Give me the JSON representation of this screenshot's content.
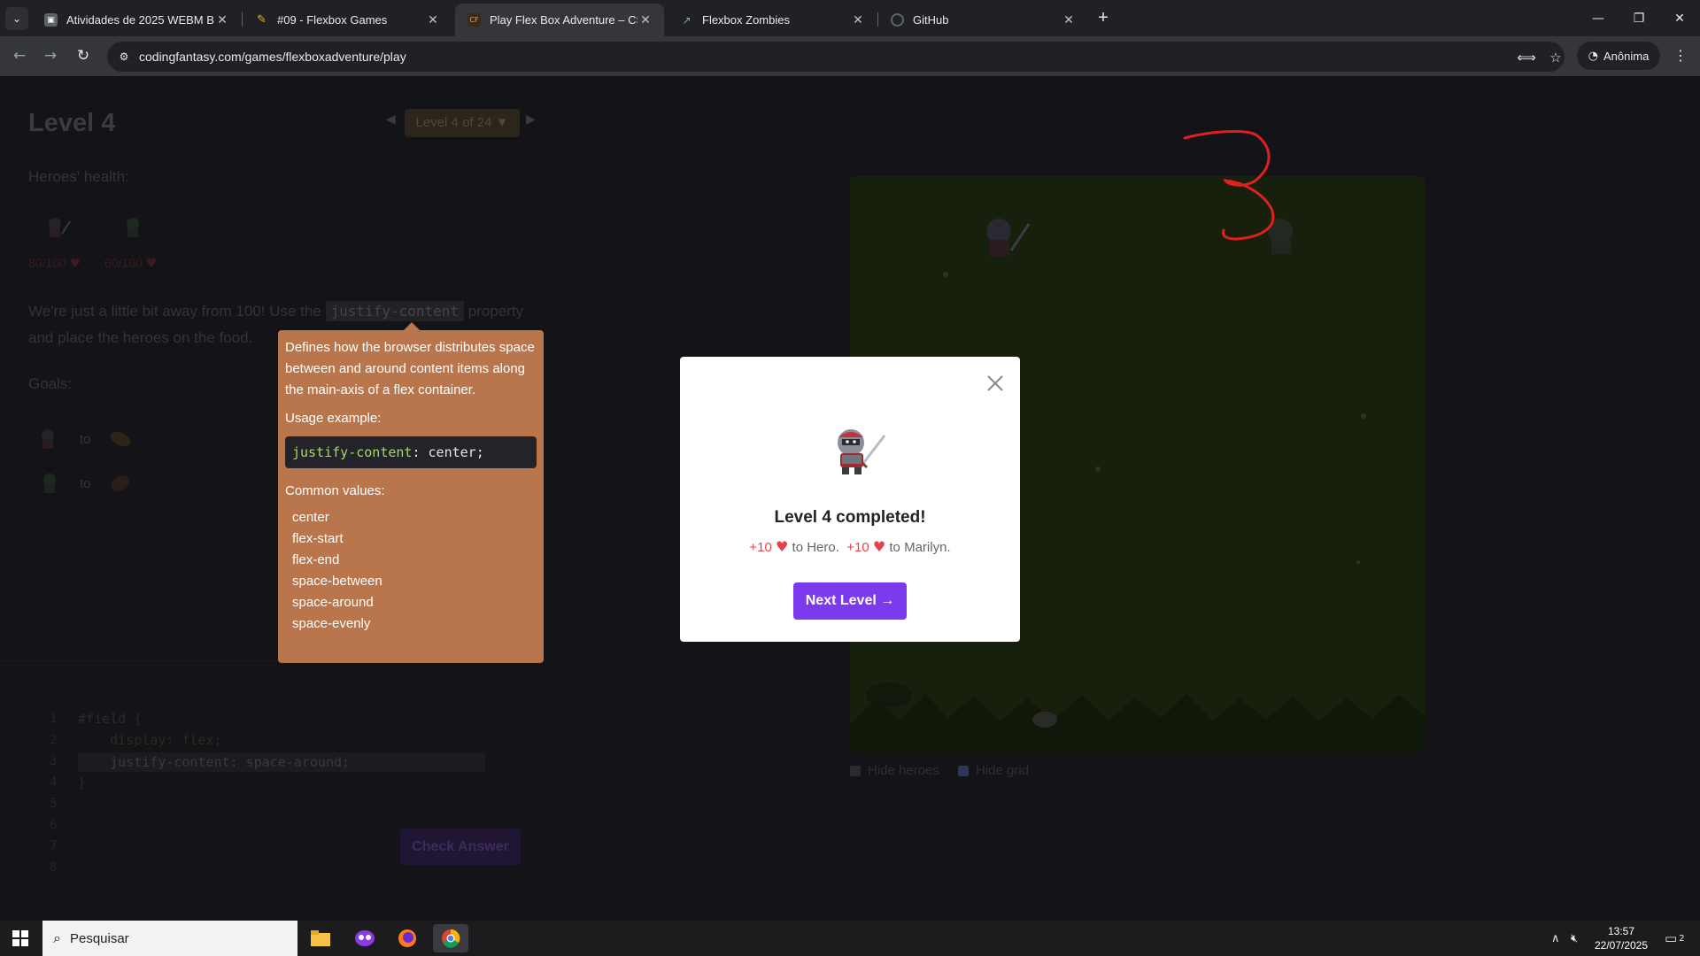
{
  "browser": {
    "tabs": [
      {
        "title": "Atividades de 2025 WEBM B",
        "active": false
      },
      {
        "title": "#09 - Flexbox Games",
        "active": false
      },
      {
        "title": "Play Flex Box Adventure – CSS C",
        "active": true
      },
      {
        "title": "Flexbox Zombies",
        "active": false
      },
      {
        "title": "GitHub",
        "active": false
      }
    ],
    "url": "codingfantasy.com/games/flexboxadventure/play",
    "profile_label": "Anônima"
  },
  "level": {
    "title": "Level 4",
    "selector_label": "Level 4 of 24 ▼",
    "heroes_health_label": "Heroes' health:",
    "hero1_health": "80/100",
    "hero2_health": "60/100",
    "instruction_part1": "We're just a little bit away from 100! Use the",
    "instruction_code": "justify-content",
    "instruction_part2": "property",
    "instruction_part3": "and place the heroes on the food.",
    "goals_label": "Goals:",
    "goal_to": "to"
  },
  "tooltip": {
    "description": "Defines how the browser distributes space between and around content items along the main-axis of a flex container.",
    "usage_label": "Usage example:",
    "usage_prop": "justify-content",
    "usage_value": ": center;",
    "common_label": "Common values:",
    "values": [
      "center",
      "flex-start",
      "flex-end",
      "space-between",
      "space-around",
      "space-evenly"
    ]
  },
  "editor": {
    "line_numbers": [
      "1",
      "2",
      "3",
      "4",
      "5",
      "6",
      "7",
      "8"
    ],
    "lines": [
      "#field {",
      "    display: flex;",
      "    justify-content: space-around;",
      "}"
    ],
    "check_button": "Check Answer"
  },
  "field": {
    "hide_heroes": "Hide heroes",
    "hide_grid": "Hide grid",
    "hide_heroes_checked": false,
    "hide_grid_checked": true
  },
  "modal": {
    "title": "Level 4 completed!",
    "reward1_amount": "+10",
    "reward1_target": "to Hero.",
    "reward2_amount": "+10",
    "reward2_target": "to Marilyn.",
    "next_button": "Next Level →"
  },
  "taskbar": {
    "search_placeholder": "Pesquisar",
    "time": "13:57",
    "date": "22/07/2025",
    "notification_count": "2"
  },
  "colors": {
    "accent_purple": "#7c3aed",
    "tooltip_bg": "#b9764c",
    "heart_red": "#e0454f"
  }
}
